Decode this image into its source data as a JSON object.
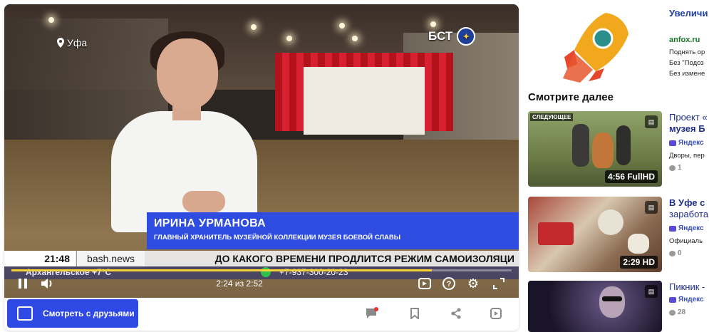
{
  "player": {
    "location_tag": "Уфа",
    "channel_logo": "БСТ",
    "lower_third": {
      "name": "ИРИНА УРМАНОВА",
      "role": "ГЛАВНЫЙ ХРАНИТЕЛЬ МУЗЕЙНОЙ КОЛЛЕКЦИИ МУЗЕЯ БОЕВОЙ СЛАВЫ"
    },
    "ticker": {
      "time": "21:48",
      "site": "bash.news",
      "headline": "ДО КАКОГО ВРЕМЕНИ ПРОДЛИТСЯ РЕЖИМ САМОИЗОЛЯЦИ",
      "weather": "Архангельское  +7°С",
      "phone": "+7-937-300-20-23"
    },
    "time_display": "2:24 из 2:52",
    "progress_fraction": 0.84,
    "icons": {
      "pause": "pause-icon",
      "volume": "volume-icon",
      "pip": "picture-in-picture-icon",
      "help": "help-icon",
      "settings": "gear-icon",
      "fullscreen": "fullscreen-icon"
    }
  },
  "bottom_bar": {
    "watch_with_friends": "Смотреть с друзьями",
    "icons": [
      "comment-icon",
      "bookmark-icon",
      "share-icon",
      "copy-icon"
    ]
  },
  "ad": {
    "title": "Увеличи онлайн",
    "domain": "anfox.ru",
    "lines": [
      "Поднять ор",
      "Без \"Подоз",
      "Без измене"
    ]
  },
  "sidebar": {
    "heading": "Смотрите далее",
    "items": [
      {
        "tag": "СЛЕДУЮЩЕЕ",
        "duration": "4:56 FullHD",
        "title_1": "Проект «",
        "title_2": "музея Б",
        "channel": "Яндекс",
        "desc": "Дворы, пер",
        "comments": "1"
      },
      {
        "duration": "2:29 HD",
        "title_1": "В Уфе с",
        "title_2": "заработа",
        "channel": "Яндекс",
        "desc": "Официаль",
        "comments": "0"
      },
      {
        "title_1": "Пикник -",
        "channel": "Яндекс",
        "comments": "28"
      }
    ]
  }
}
